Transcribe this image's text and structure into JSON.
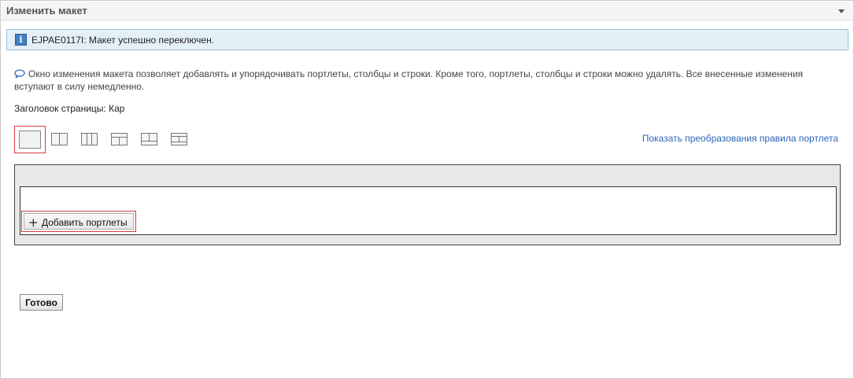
{
  "portlet": {
    "title": "Изменить макет"
  },
  "message": {
    "text": "EJPAE0117I: Макет успешно переключен."
  },
  "description": {
    "text": "Окно изменения макета позволяет добавлять и упорядочивать портлеты, столбцы и строки. Кроме того, портлеты, столбцы и строки можно удалять. Все внесенные изменения вступают в силу немедленно."
  },
  "page_title": {
    "text": "Заголовок страницы: Кар"
  },
  "layouts": {
    "selected": "one-column",
    "options": [
      "one-column",
      "two-columns",
      "three-columns",
      "row-two-columns",
      "two-columns-row",
      "row-two-columns-row"
    ]
  },
  "links": {
    "show_rule_transformations": "Показать преобразования правила портлета"
  },
  "buttons": {
    "add_portlets": "Добавить портлеты",
    "done": "Готово"
  },
  "colors": {
    "accent_link": "#2d66b7",
    "selection_outline": "#d33c3c",
    "info_background": "#e4f0f8"
  }
}
